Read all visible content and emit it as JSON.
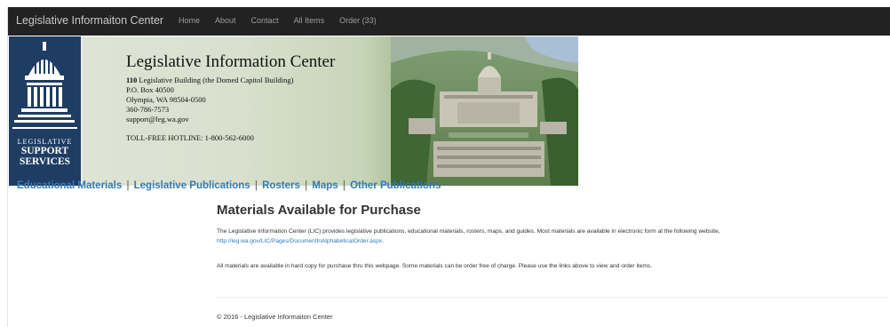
{
  "navbar": {
    "brand": "Legislative Informaiton Center",
    "links": [
      "Home",
      "About",
      "Contact",
      "All Items",
      "Order (33)"
    ]
  },
  "banner": {
    "logo": {
      "line1": "LEGISLATIVE",
      "line2": "SUPPORT",
      "line3": "SERVICES"
    },
    "title": "Legislative Information Center",
    "address_number": "110",
    "address_rest": "Legislative Building (the Domed Capitol Building)",
    "po_box": "P.O. Box 40500",
    "city": "Olympia, WA 98504-0500",
    "phone": "360-786-7573",
    "email": "support@leg.wa.gov",
    "hotline": "TOLL-FREE HOTLINE: 1-800-562-6000",
    "photo_icon": "capitol-building-photo"
  },
  "categories": [
    "Educational Materials",
    "Legislative Publications",
    "Rosters",
    "Maps",
    "Other Publications"
  ],
  "category_separator": "|",
  "main": {
    "title": "Materials Available for Purchase",
    "para1": "The Legislative Information Center (LIC) provides legislative publications, educational materials, rosters, maps, and guides.  Most materials are available in electronic form at the following website,",
    "link": "http://leg.wa.gov/LIC/Pages/DocumentInAlphabeticalOrder.aspx.",
    "para2": "All materials are available in hard copy for purchase thru this webpage. Some materials can be order free of charge.  Please use the links above to view and order items."
  },
  "footer": "© 2016 - Legislative Informaiton Center",
  "colors": {
    "navbar_bg": "#222222",
    "link": "#337ab7",
    "logo_bg": "#1f3d63"
  }
}
